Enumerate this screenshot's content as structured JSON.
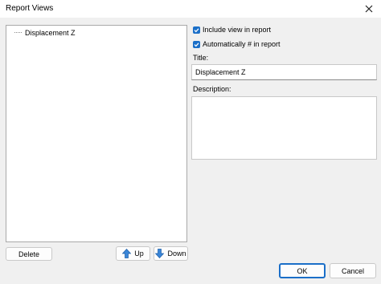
{
  "window": {
    "title": "Report Views"
  },
  "tree": {
    "items": [
      "Displacement Z"
    ]
  },
  "options": {
    "include_view": {
      "label": "Include view in report",
      "checked": true
    },
    "auto_number": {
      "label": "Automatically # in report",
      "checked": true
    }
  },
  "form": {
    "title_label": "Title:",
    "title_value": "Displacement Z",
    "description_label": "Description:",
    "description_value": ""
  },
  "buttons": {
    "delete": "Delete",
    "up": "Up",
    "down": "Down",
    "ok": "OK",
    "cancel": "Cancel"
  },
  "colors": {
    "checkbox": "#1b6fc8",
    "arrow": "#3a86d8"
  }
}
